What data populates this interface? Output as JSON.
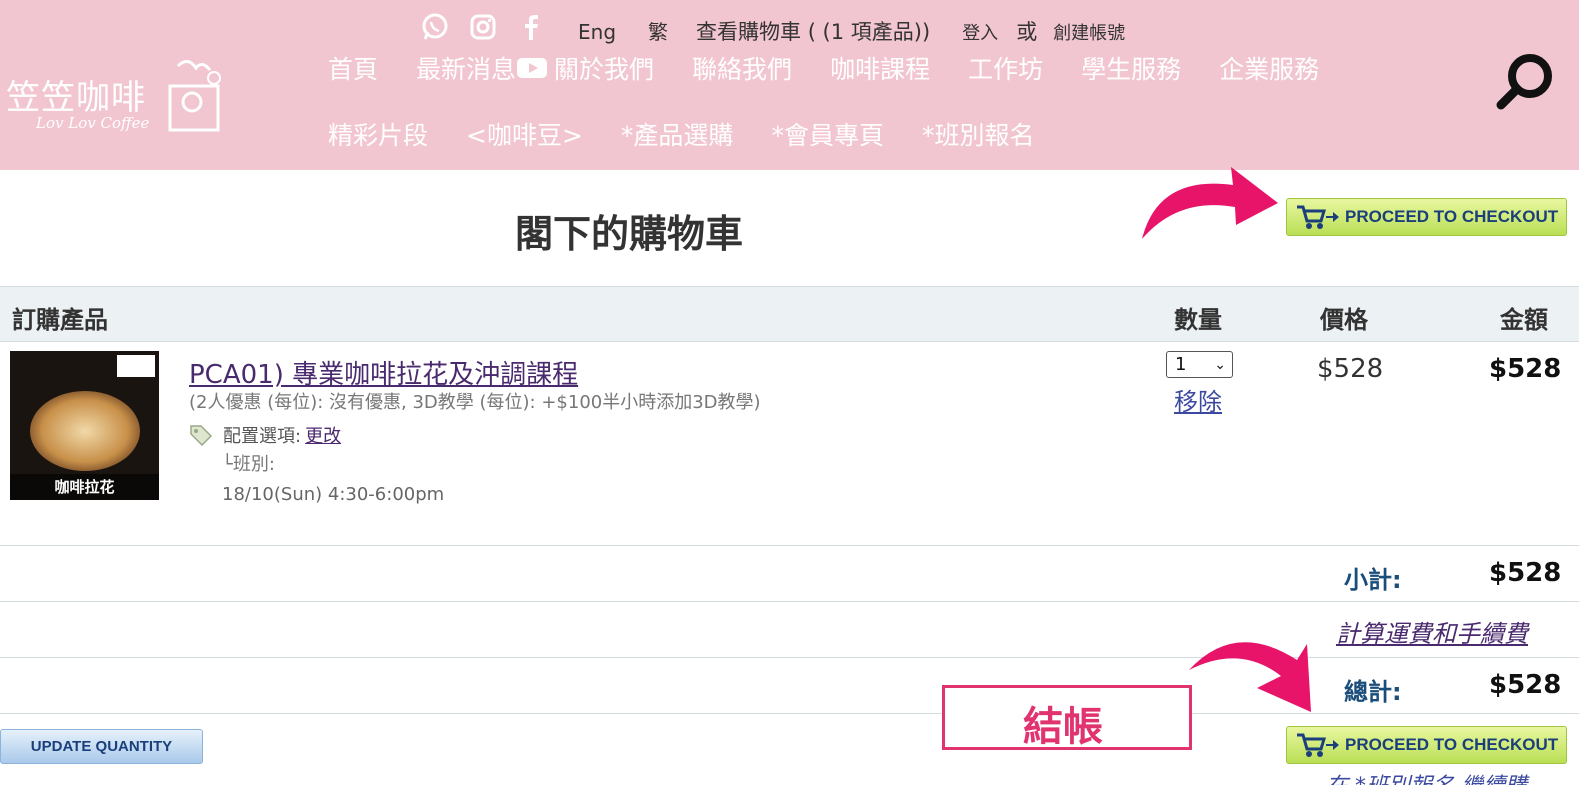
{
  "header": {
    "logo_cn": "笠笠咖啡",
    "logo_en": "Lov Lov Coffee",
    "lang_en": "Eng",
    "lang_tc": "繁",
    "view_cart": "查看購物車 ( (1 項產品))",
    "login": "登入",
    "or": "或",
    "register": "創建帳號",
    "nav_row1": [
      "首頁",
      "最新消息",
      "關於我們",
      "聯絡我們",
      "咖啡課程",
      "工作坊",
      "學生服務",
      "企業服務"
    ],
    "nav_row2": [
      "精彩片段",
      "<咖啡豆>",
      "*產品選購",
      "*會員專頁",
      "*班別報名"
    ],
    "icons": [
      "whatsapp-icon",
      "instagram-icon",
      "facebook-icon",
      "youtube-icon",
      "search-icon"
    ],
    "bg_color": "#f2c6d0"
  },
  "page": {
    "title": "閣下的購物車",
    "checkout_label": "PROCEED TO CHECKOUT",
    "update_label": "UPDATE QUANTITY",
    "annotation": "結帳",
    "partial_bottom": "在 *班別報名 繼續購"
  },
  "table": {
    "headers": {
      "product": "訂購產品",
      "qty": "數量",
      "price": "價格",
      "total": "金額"
    },
    "items": [
      {
        "image_label": "咖啡拉花",
        "name": "PCA01) 專業咖啡拉花及沖調課程",
        "options": "(2人優惠 (每位): 沒有優惠, 3D教學 (每位): +$100半小時添加3D教學)",
        "config_label": "配置選項:",
        "config_link": "更改",
        "branch": "└班別:",
        "time": "18/10(Sun) 4:30-6:00pm",
        "qty": "1",
        "remove": "移除",
        "price": "$528",
        "amount": "$528"
      }
    ]
  },
  "summary": {
    "subtotal_label": "小計:",
    "subtotal": "$528",
    "shipping_link": "計算運費和手續費",
    "grand_label": "總計:",
    "grand": "$528"
  }
}
